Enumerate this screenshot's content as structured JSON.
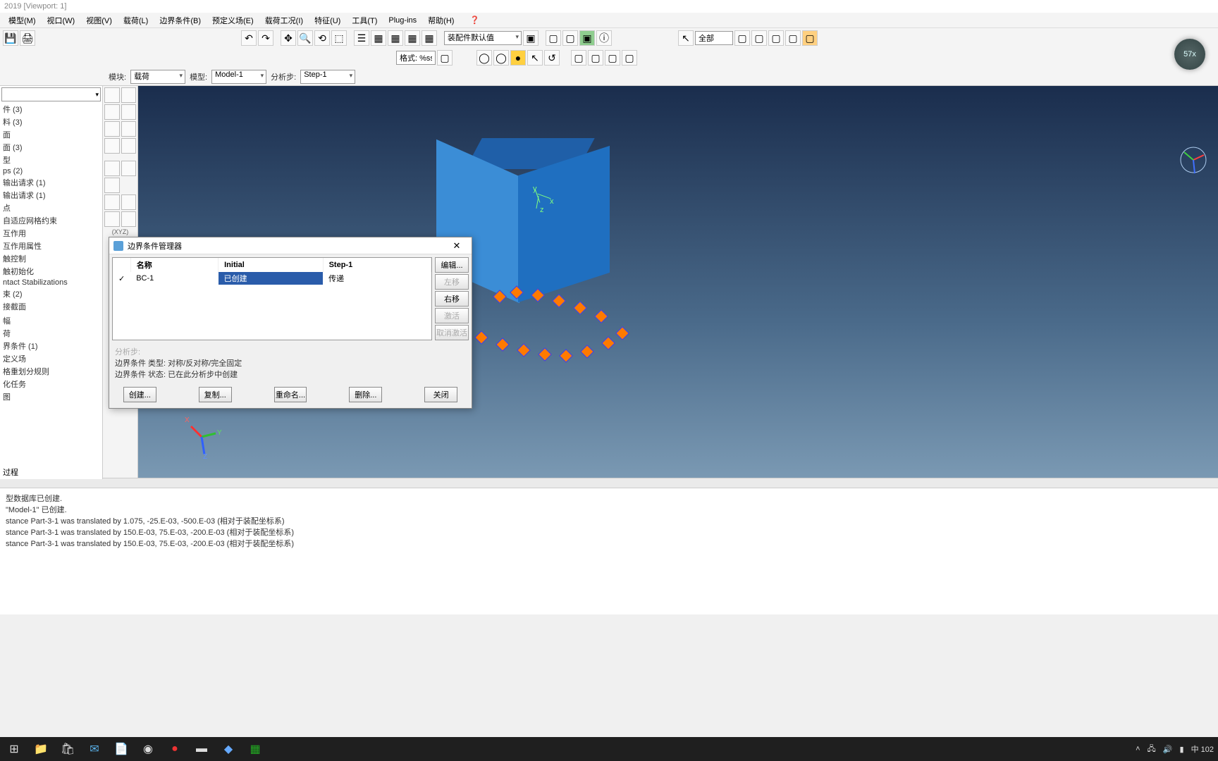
{
  "title": "2019 [Viewport: 1]",
  "menus": [
    "模型(M)",
    "视口(W)",
    "视图(V)",
    "载荷(L)",
    "边界条件(B)",
    "预定义场(E)",
    "载荷工况(I)",
    "特征(U)",
    "工具(T)",
    "Plug-ins",
    "帮助(H)"
  ],
  "toolbar2_input": "格式: %ss",
  "combo_assembly": "装配件默认值",
  "combo_all": "全部",
  "context": {
    "module_label": "模块:",
    "module_value": "载荷",
    "model_label": "模型:",
    "model_value": "Model-1",
    "step_label": "分析步:",
    "step_value": "Step-1"
  },
  "tree_items": [
    "件 (3)",
    "料 (3)",
    "面",
    "面 (3)",
    "型",
    "ps (2)",
    "输出请求 (1)",
    "输出请求 (1)",
    "点",
    "自适应网格约束",
    "互作用",
    "互作用属性",
    "触控制",
    "触初始化",
    "ntact Stabilizations",
    "束 (2)",
    "接截面",
    "",
    "幅",
    "荷",
    "界条件 (1)",
    "定义场",
    "格重划分规则",
    "化任务",
    "图"
  ],
  "tree_process": "过程",
  "side_label": "(XYZ)",
  "dialog": {
    "title": "边界条件管理器",
    "cols": [
      "名称",
      "Initial",
      "Step-1"
    ],
    "row": {
      "check": "✓",
      "name": "BC-1",
      "initial": "已创建",
      "step1": "传递"
    },
    "btn_edit": "编辑...",
    "btn_left": "左移",
    "btn_right": "右移",
    "btn_act": "激活",
    "btn_deact": "取消激活",
    "info_step": "分析步:",
    "info_type": "边界条件 类型: 对称/反对称/完全固定",
    "info_status": "边界条件 状态: 已在此分析步中创建",
    "btn_create": "创建...",
    "btn_copy": "复制...",
    "btn_rename": "重命名...",
    "btn_delete": "删除...",
    "btn_close": "关闭"
  },
  "console_lines": [
    "型数据库已创建.",
    "\"Model-1\" 已创建.",
    "stance Part-3-1 was translated by 1.075, -25.E-03, -500.E-03 (相对于装配坐标系)",
    "stance Part-3-1 was translated by 150.E-03, 75.E-03, -200.E-03 (相对于装配坐标系)",
    "stance Part-3-1 was translated by 150.E-03, 75.E-03, -200.E-03 (相对于装配坐标系)"
  ],
  "seek": "57x",
  "axes": {
    "x": "X",
    "y": "Y",
    "z": "Z"
  },
  "tray_text": "中 102"
}
